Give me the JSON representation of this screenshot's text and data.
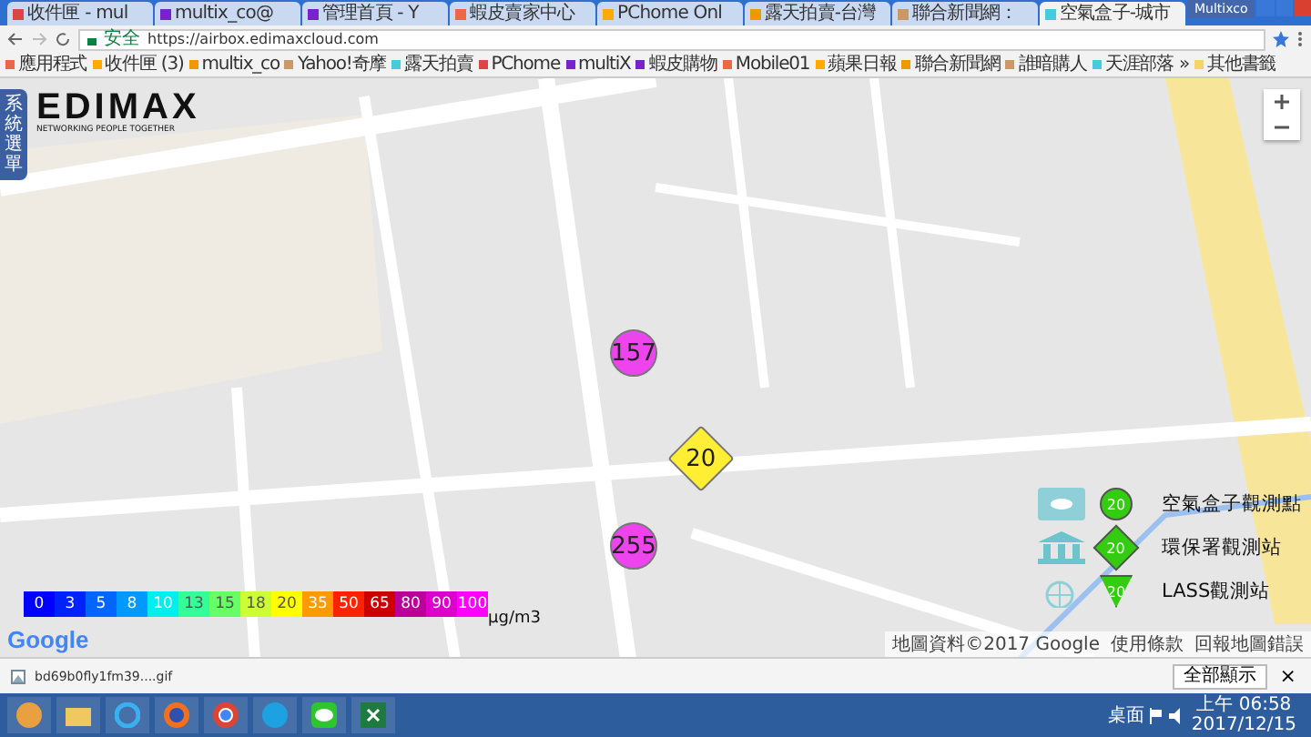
{
  "browser": {
    "tabs": [
      {
        "title": "收件匣 - mul",
        "selected": false
      },
      {
        "title": "multix_co@",
        "selected": false
      },
      {
        "title": "管理首頁 - Y",
        "selected": false
      },
      {
        "title": "蝦皮賣家中心",
        "selected": false
      },
      {
        "title": "PChome Onl",
        "selected": false
      },
      {
        "title": "露天拍賣-台灣",
        "selected": false
      },
      {
        "title": "聯合新聞網：",
        "selected": false
      },
      {
        "title": "空氣盒子-城市",
        "selected": true
      }
    ],
    "profile": "Multixco",
    "address": {
      "security": "安全",
      "url": "https://airbox.edimaxcloud.com"
    },
    "bookmarks": [
      "應用程式",
      "收件匣 (3)",
      "multix_co",
      "Yahoo!奇摩",
      "露天拍賣",
      "PChome",
      "multiX",
      "蝦皮購物",
      "Mobile01",
      "蘋果日報",
      "聯合新聞網",
      "誰暗購人",
      "天涯部落"
    ],
    "more": "»",
    "other_bookmarks": "其他書籤"
  },
  "page": {
    "menu_tab": "系統選單",
    "logo": {
      "brand": "EDIMAX",
      "tagline": "NETWORKING PEOPLE TOGETHER"
    },
    "markers": [
      {
        "value": "157",
        "kind": "airbox",
        "color": "#ee44ee"
      },
      {
        "value": "20",
        "kind": "epa",
        "color": "#ffee33"
      },
      {
        "value": "255",
        "kind": "airbox",
        "color": "#ee44ee"
      }
    ],
    "scale": {
      "steps": [
        {
          "label": "0",
          "color": "#0000ff"
        },
        {
          "label": "3",
          "color": "#0022ff"
        },
        {
          "label": "5",
          "color": "#0066ff"
        },
        {
          "label": "8",
          "color": "#0099ff"
        },
        {
          "label": "10",
          "color": "#00eeee"
        },
        {
          "label": "13",
          "color": "#33ff99"
        },
        {
          "label": "15",
          "color": "#66ff66"
        },
        {
          "label": "18",
          "color": "#ccff33"
        },
        {
          "label": "20",
          "color": "#ffff00"
        },
        {
          "label": "35",
          "color": "#ff9900"
        },
        {
          "label": "50",
          "color": "#ff2200"
        },
        {
          "label": "65",
          "color": "#cc0000"
        },
        {
          "label": "80",
          "color": "#bb0099"
        },
        {
          "label": "90",
          "color": "#dd00cc"
        },
        {
          "label": "100",
          "color": "#ff00ff"
        }
      ],
      "unit": "μg/m3"
    },
    "legend": [
      {
        "kind": "airbox",
        "value": "20",
        "label": "空氣盒子觀測點"
      },
      {
        "kind": "epa",
        "value": "20",
        "label": "環保署觀測站"
      },
      {
        "kind": "lass",
        "value": "20",
        "label": "LASS觀測站"
      }
    ],
    "map": {
      "kind": "picture",
      "google": "Google",
      "attribution": "地圖資料©2017 Google",
      "links": [
        "使用條款",
        "回報地圖錯誤"
      ]
    }
  },
  "download_bar": {
    "file": "bd69b0fly1fm39....gif",
    "show_all": "全部顯示",
    "close": "×"
  },
  "taskbar": {
    "desktop": "桌面",
    "time": "上午 06:58",
    "date": "2017/12/15"
  }
}
